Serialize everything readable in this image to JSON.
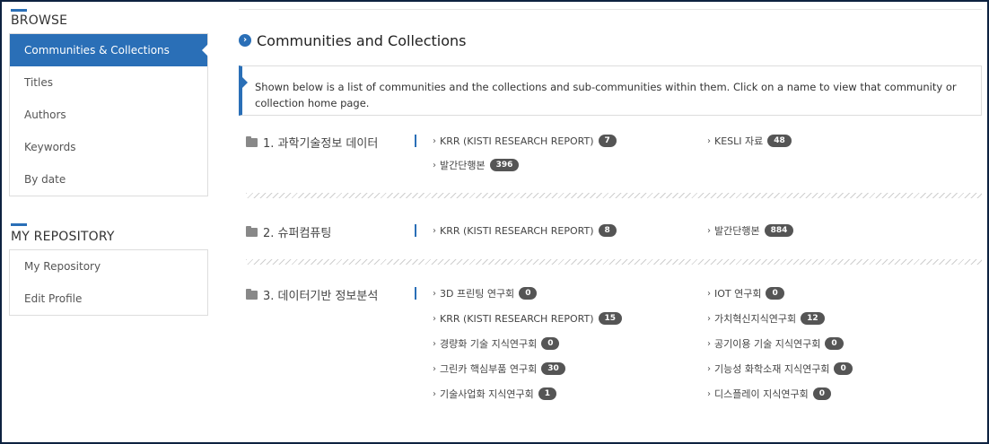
{
  "sidebar": {
    "browse_heading": "BROWSE",
    "browse_items": [
      "Communities & Collections",
      "Titles",
      "Authors",
      "Keywords",
      "By date"
    ],
    "repo_heading": "MY REPOSITORY",
    "repo_items": [
      "My Repository",
      "Edit Profile"
    ]
  },
  "main": {
    "title_icon": "chevron-right-circle-icon",
    "title": "Communities and Collections",
    "info": "Shown below is a list of communities and the collections and sub-communities within them. Click on a name to view that community or collection home page.",
    "communities": [
      {
        "name": "1. 과학기술정보 데이터",
        "collections": [
          {
            "label": "KRR (KISTI RESEARCH REPORT)",
            "count": "7"
          },
          {
            "label": "KESLI 자료",
            "count": "48"
          },
          {
            "label": "발간단행본",
            "count": "396"
          }
        ]
      },
      {
        "name": "2. 슈퍼컴퓨팅",
        "collections": [
          {
            "label": "KRR (KISTI RESEARCH REPORT)",
            "count": "8"
          },
          {
            "label": "발간단행본",
            "count": "884"
          }
        ]
      },
      {
        "name": "3. 데이터기반 정보분석",
        "collections": [
          {
            "label": "3D 프린팅 연구회",
            "count": "0"
          },
          {
            "label": "IOT 연구회",
            "count": "0"
          },
          {
            "label": "KRR (KISTI RESEARCH REPORT)",
            "count": "15"
          },
          {
            "label": "가치혁신지식연구회",
            "count": "12"
          },
          {
            "label": "경량화 기술 지식연구회",
            "count": "0"
          },
          {
            "label": "공기이용 기술 지식연구회",
            "count": "0"
          },
          {
            "label": "그린카 핵심부품 연구회",
            "count": "30"
          },
          {
            "label": "기능성 화학소재 지식연구회",
            "count": "0"
          },
          {
            "label": "기술사업화 지식연구회",
            "count": "1"
          },
          {
            "label": "디스플레이 지식연구회",
            "count": "0"
          }
        ]
      }
    ]
  },
  "colors": {
    "accent": "#2a6fb7",
    "badge": "#555555",
    "frame": "#0d2240"
  }
}
